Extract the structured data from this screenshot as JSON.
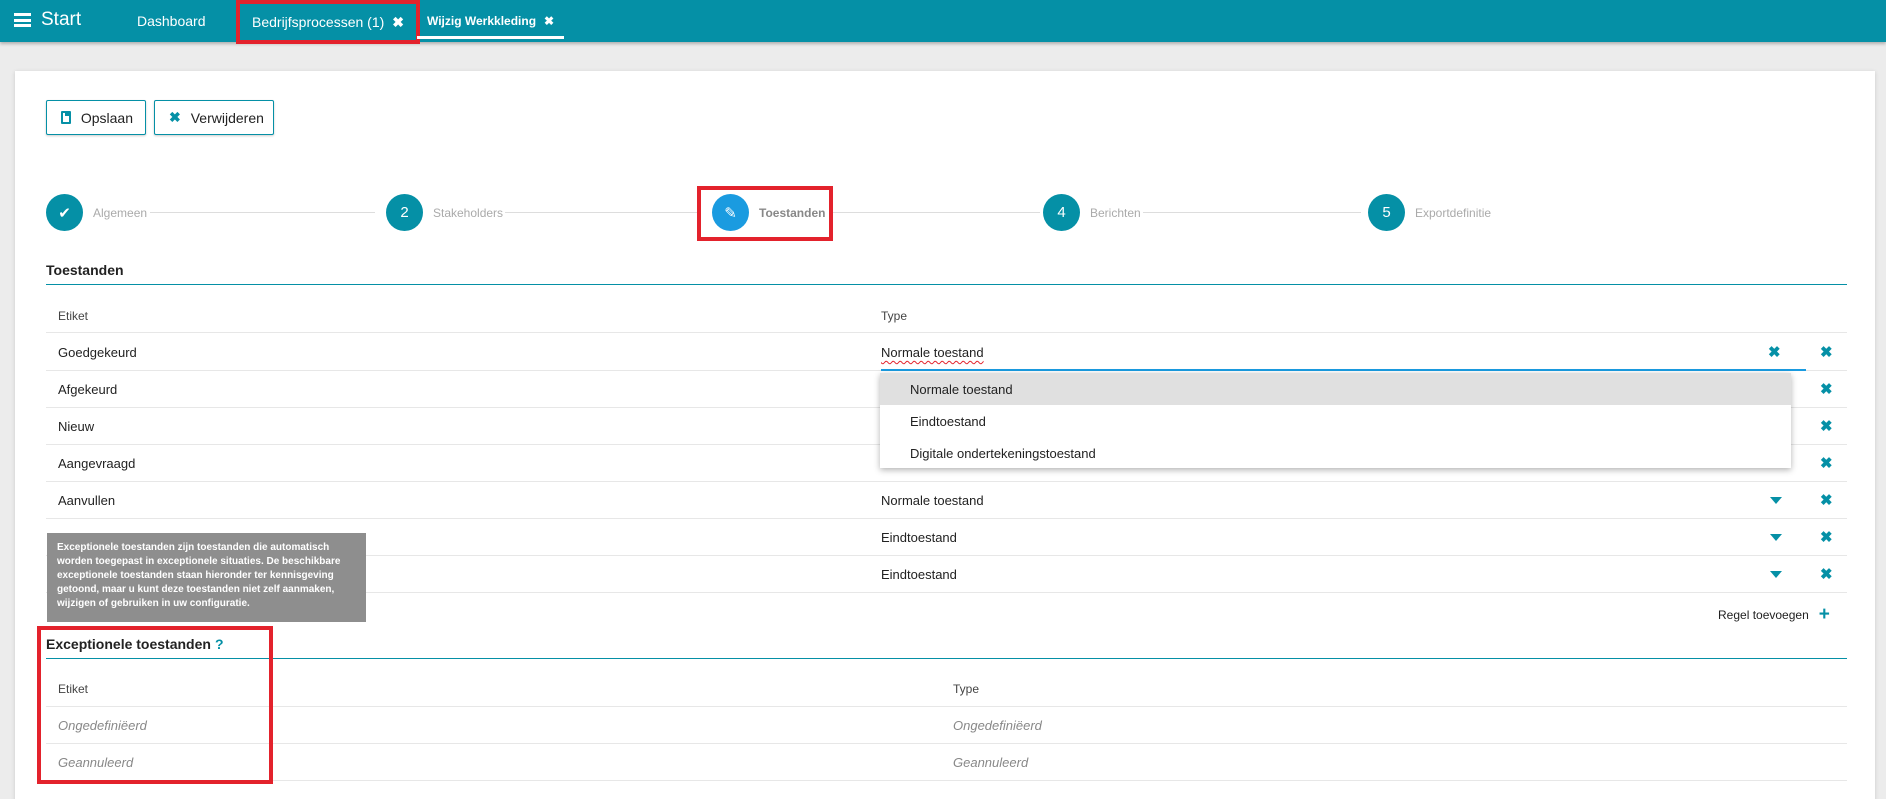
{
  "topbar": {
    "start_label": "Start",
    "tabs": [
      {
        "label": "Dashboard"
      },
      {
        "label": "Bedrijfsprocessen (1)"
      },
      {
        "label": "Wijzig Werkkleding"
      }
    ],
    "accent": "#0590a6"
  },
  "toolbar": {
    "save_label": "Opslaan",
    "delete_label": "Verwijderen"
  },
  "stepper": {
    "steps": [
      {
        "number": "",
        "label": "Algemeen",
        "status": "done"
      },
      {
        "number": "2",
        "label": "Stakeholders",
        "status": "todo"
      },
      {
        "number": "",
        "label": "Toestanden",
        "status": "active"
      },
      {
        "number": "4",
        "label": "Berichten",
        "status": "todo"
      },
      {
        "number": "5",
        "label": "Exportdefinitie",
        "status": "todo"
      }
    ]
  },
  "states": {
    "title": "Toestanden",
    "col_label": "Etiket",
    "col_type": "Type",
    "rows": [
      {
        "label": "Goedgekeurd",
        "type": "Normale toestand"
      },
      {
        "label": "Afgekeurd",
        "type": ""
      },
      {
        "label": "Nieuw",
        "type": ""
      },
      {
        "label": "Aangevraagd",
        "type": ""
      },
      {
        "label": "Aanvullen",
        "type": "Normale toestand"
      },
      {
        "label": "",
        "type": "Eindtoestand"
      },
      {
        "label": "",
        "type": "Eindtoestand"
      }
    ],
    "dropdown_options": [
      "Normale toestand",
      "Eindtoestand",
      "Digitale ondertekeningstoestand"
    ],
    "add_row_label": "Regel toevoegen"
  },
  "tooltip": {
    "text": "Exceptionele toestanden zijn toestanden die automatisch worden toegepast in exceptionele situaties. De beschikbare exceptionele toestanden staan hieronder ter kennisgeving getoond, maar u kunt deze toestanden niet zelf aanmaken, wijzigen of gebruiken in uw configuratie."
  },
  "exceptional": {
    "title": "Exceptionele toestanden",
    "help": "?",
    "col_label": "Etiket",
    "col_type": "Type",
    "rows": [
      {
        "label": "Ongedefiniëerd",
        "type": "Ongedefiniëerd"
      },
      {
        "label": "Geannuleerd",
        "type": "Geannuleerd"
      }
    ]
  }
}
